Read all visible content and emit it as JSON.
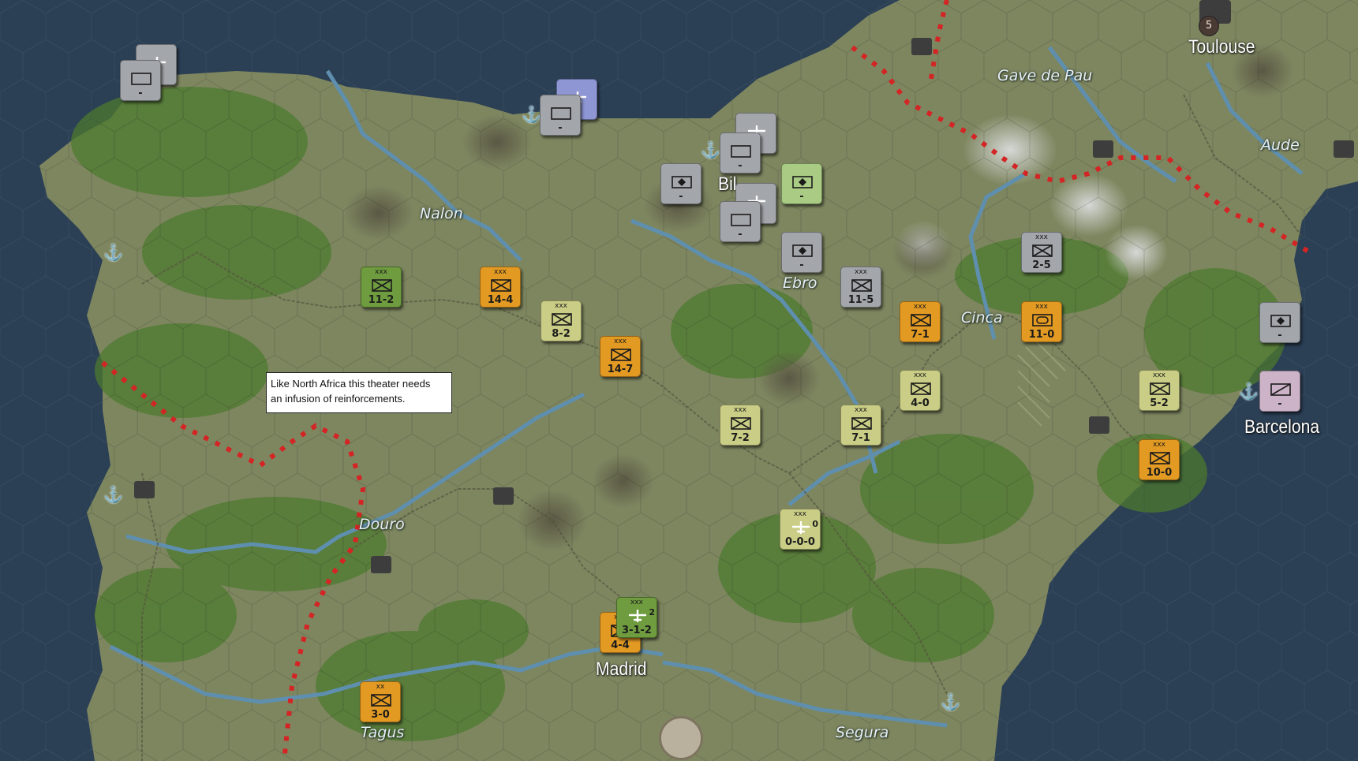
{
  "map": {
    "sea_color": "#2b3f55",
    "land_color": "#7e8660",
    "forest_color": "#4e7a2f",
    "border_color": "#d42424",
    "river_color": "#5f8fae"
  },
  "rivers": [
    "Nalon",
    "Ebro",
    "Cinca",
    "Gave de Pau",
    "Aude",
    "Douro",
    "Tagus",
    "Segura"
  ],
  "cities": [
    "Toulouse",
    "Barcelona",
    "Madrid",
    "Bil"
  ],
  "city_badge": {
    "label": "5"
  },
  "tooltip": {
    "line1": "Like North Africa this theater needs",
    "line2": "an infusion of reinforcements."
  },
  "units": [
    {
      "id": "air-nw",
      "kind": "air",
      "color": "grey",
      "size": "",
      "value": "-"
    },
    {
      "id": "air-nw-back",
      "kind": "blank",
      "color": "grey",
      "size": "",
      "value": "-"
    },
    {
      "id": "air-north-blue",
      "kind": "air",
      "color": "blue",
      "size": "",
      "value": "-"
    },
    {
      "id": "air-north-blue-back",
      "kind": "blank",
      "color": "grey",
      "size": "",
      "value": "-"
    },
    {
      "id": "air-bil-1",
      "kind": "air",
      "color": "grey",
      "size": "",
      "value": "-"
    },
    {
      "id": "air-bil-1-back",
      "kind": "blank",
      "color": "grey",
      "size": "",
      "value": "-"
    },
    {
      "id": "air-bil-2",
      "kind": "air",
      "color": "grey",
      "size": "",
      "value": "-"
    },
    {
      "id": "air-bil-2-back",
      "kind": "blank",
      "color": "grey",
      "size": "",
      "value": "-"
    },
    {
      "id": "naval-bil-w",
      "kind": "naval",
      "color": "grey",
      "size": "",
      "value": "-"
    },
    {
      "id": "naval-bil-e",
      "kind": "naval",
      "color": "lightgreen",
      "size": "",
      "value": "-"
    },
    {
      "id": "naval-ebro",
      "kind": "naval",
      "color": "grey",
      "size": "",
      "value": "-"
    },
    {
      "id": "naval-barcelona",
      "kind": "naval",
      "color": "grey",
      "size": "",
      "value": "-"
    },
    {
      "id": "inf-11-2",
      "kind": "inf",
      "color": "green",
      "size": "xxx",
      "value": "11-2"
    },
    {
      "id": "inf-14-4",
      "kind": "inf",
      "color": "orange",
      "size": "xxx",
      "value": "14-4"
    },
    {
      "id": "inf-8-2",
      "kind": "inf",
      "color": "olive",
      "size": "xxx",
      "value": "8-2"
    },
    {
      "id": "inf-14-7",
      "kind": "inf",
      "color": "orange",
      "size": "xxx",
      "value": "14-7"
    },
    {
      "id": "inf-11-5",
      "kind": "inf",
      "color": "grey",
      "size": "xxx",
      "value": "11-5"
    },
    {
      "id": "inf-2-5",
      "kind": "inf",
      "color": "grey",
      "size": "xxx",
      "value": "2-5"
    },
    {
      "id": "inf-7-1-orange",
      "kind": "inf",
      "color": "orange",
      "size": "xxx",
      "value": "7-1"
    },
    {
      "id": "armor-11-0",
      "kind": "armor",
      "color": "orange",
      "size": "xxx",
      "value": "11-0"
    },
    {
      "id": "inf-4-0",
      "kind": "inf",
      "color": "olive",
      "size": "xxx",
      "value": "4-0"
    },
    {
      "id": "inf-7-2",
      "kind": "inf",
      "color": "olive",
      "size": "xxx",
      "value": "7-2"
    },
    {
      "id": "inf-7-1-olive",
      "kind": "inf",
      "color": "olive",
      "size": "xxx",
      "value": "7-1"
    },
    {
      "id": "inf-5-2",
      "kind": "inf",
      "color": "olive",
      "size": "xxx",
      "value": "5-2"
    },
    {
      "id": "inf-10-0",
      "kind": "inf",
      "color": "orange",
      "size": "xxx",
      "value": "10-0"
    },
    {
      "id": "cav-barcelona",
      "kind": "cav",
      "color": "pink",
      "size": "",
      "value": "-"
    },
    {
      "id": "air-0-0-0",
      "kind": "air",
      "color": "olive",
      "size": "xxx",
      "value": "0-0-0",
      "extra": "0"
    },
    {
      "id": "inf-4-4",
      "kind": "inf",
      "color": "orange",
      "size": "xxx",
      "value": "4-4"
    },
    {
      "id": "air-3-1-2",
      "kind": "air",
      "color": "green",
      "size": "xxx",
      "value": "3-1-2",
      "extra": "2"
    },
    {
      "id": "inf-3-0",
      "kind": "inf",
      "color": "orange",
      "size": "xx",
      "value": "3-0"
    }
  ]
}
